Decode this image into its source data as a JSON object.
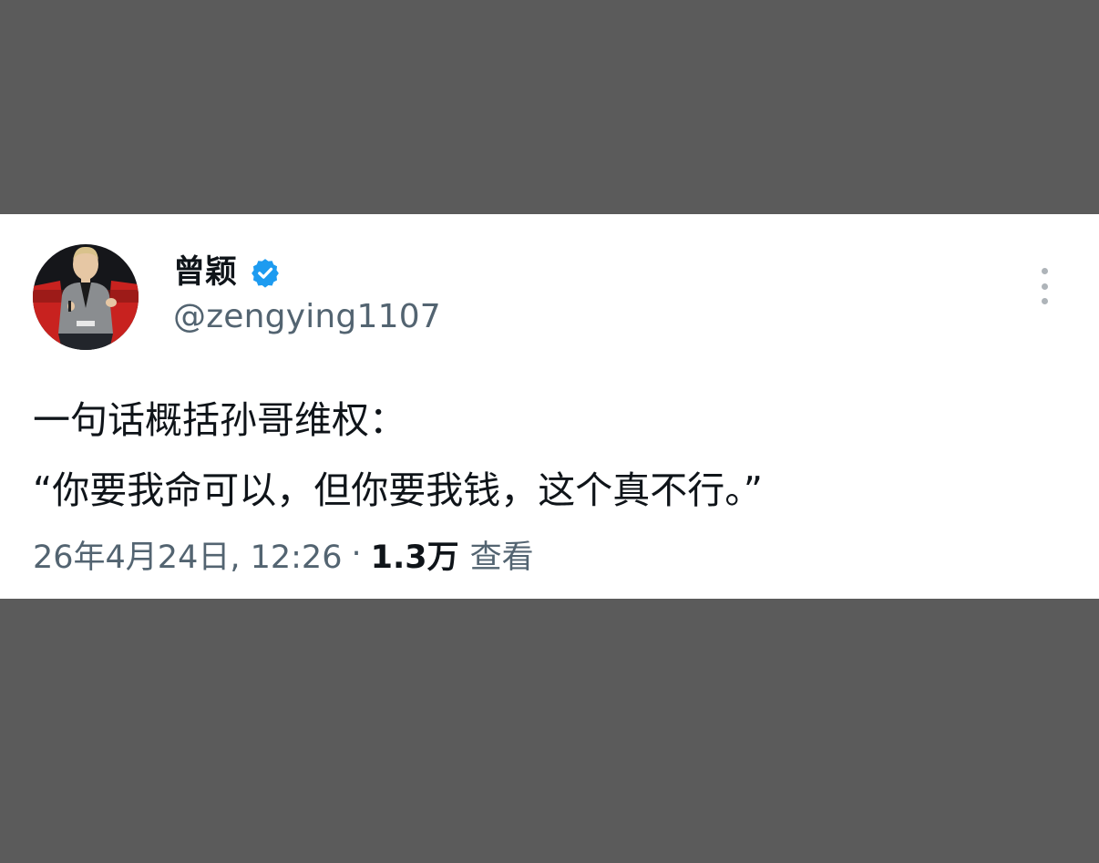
{
  "tweet": {
    "author": {
      "display_name": "曾颖",
      "handle": "@zengying1107",
      "verified": true,
      "avatar_icon": "avatar-photo-icon"
    },
    "text_lines": [
      "一句话概括孙哥维权：",
      "“你要我命可以，但你要我钱，这个真不行。”"
    ],
    "meta": {
      "date_time": "26年4月24日, 12:26",
      "separator": "·",
      "views_count": "1.3万",
      "views_label": "查看"
    },
    "more_icon": "more-options-icon"
  },
  "colors": {
    "background_band": "#5b5b5b",
    "card": "#ffffff",
    "text_primary": "#0f1419",
    "text_secondary": "#536471",
    "verified_blue": "#1d9bf0"
  }
}
